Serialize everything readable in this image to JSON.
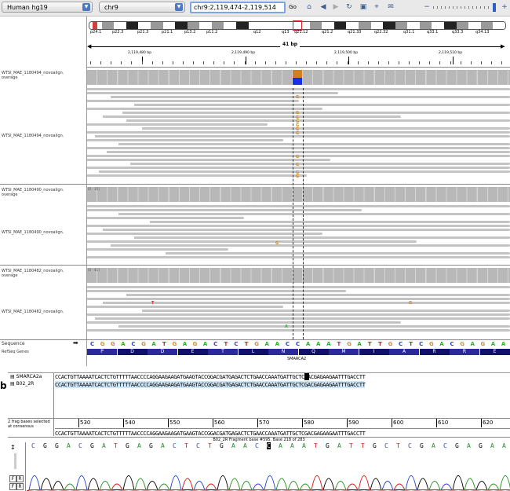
{
  "toolbar": {
    "genome": "Human hg19",
    "chromosome": "chr9",
    "locus": "chr9:2,119,474-2,119,514",
    "go_label": "Go"
  },
  "ruler": {
    "cytobands": [
      "p24.1",
      "p22.3",
      "p21.3",
      "p21.1",
      "p13.2",
      "p11.2",
      "q12",
      "q13",
      "q21.12",
      "q21.2",
      "q21.33",
      "q22.32",
      "q31.1",
      "q33.1",
      "q33.3",
      "q34.13"
    ],
    "span_label": "41 bp",
    "ticks": [
      "2,119,480 bp",
      "2,119,490 bp",
      "2,119,500 bp",
      "2,119,510 bp"
    ]
  },
  "tracks": [
    {
      "coverage_label": "WTSI_MAE_1180494_novoalign.\noverage",
      "reads_label": "WTSI_MAE_1180494_novoalign.",
      "range": "[0 - 41]"
    },
    {
      "coverage_label": "WTSI_MAE_1180490_novoalign.\noverage",
      "reads_label": "WTSI_MAE_1180490_novoalign.",
      "range": "[0 - 35]"
    },
    {
      "coverage_label": "WTSI_MAE_1180482_novoalign.\noverage",
      "reads_label": "WTSI_MAE_1180482_novoalign.",
      "range": "[0 - 41]"
    }
  ],
  "sequence": {
    "label": "Sequence",
    "refseq_label": "RefSeq Genes",
    "bases": "CGGACGATGAGACTCTGAACCAAATGATTGCTCGACGAGAA",
    "amino_acids": [
      "P",
      "D",
      "D",
      "E",
      "T",
      "L",
      "N",
      "Q",
      "M",
      "I",
      "A",
      "R",
      "R",
      "E"
    ],
    "gene": "SMARCA2"
  },
  "panel_b": {
    "letter": "b",
    "files": [
      "SMARCA2a",
      "B02_2R"
    ],
    "seq1": "CCACTGTTAAAATCACTCTGTTTTTAACCCCAGGAAGAAGATGAAGTACCGGACGATGAGACTCTGAACCAAATGATTGCTCGACGAGAAGAATTTGACCTT",
    "seq2": "CCACTGTTAAAATCACTCTGTTTTTAACCCCAGGAAGAAGATGAAGTACCGGACGATGAGACTCTGAACCAAATGATTGCTCGACGAGAAGAATTTGACCTT",
    "ruler_numbers": [
      "530",
      "540",
      "550",
      "560",
      "570",
      "580",
      "590",
      "600",
      "610",
      "620"
    ],
    "consensus_label": "2 frag bases selected at consensus",
    "consensus": "CCACTGTTAAAATCACTCTGTTTTTAACCCCAGGAAGAAGATGAAGTACCGGACGATGAGACTCTGAACCAAATGATTGCTCGACGAGAAGAATTTGACCTT",
    "fragment_info": "B02_2R Fragment base #595. Base 218 of 283",
    "trace_bases": "CGGACGATGAGACTCTGAACCAAATGATTGCTCGACGAGAA"
  }
}
